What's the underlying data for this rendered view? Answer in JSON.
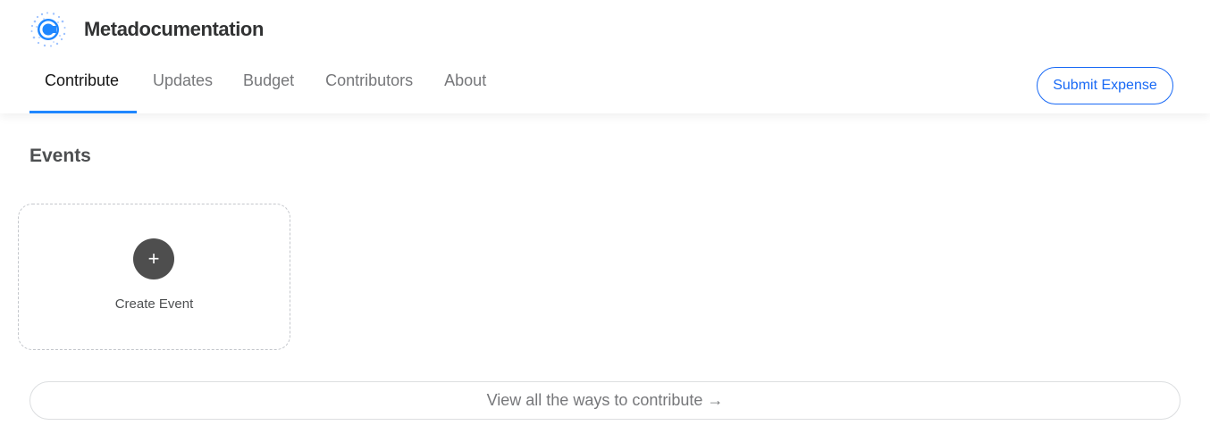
{
  "collective": {
    "name": "Metadocumentation",
    "logo_icon": "opencollective-logo-icon"
  },
  "nav": {
    "items": [
      {
        "label": "Contribute",
        "active": true
      },
      {
        "label": "Updates",
        "active": false
      },
      {
        "label": "Budget",
        "active": false
      },
      {
        "label": "Contributors",
        "active": false
      },
      {
        "label": "About",
        "active": false
      }
    ],
    "submit_expense_label": "Submit Expense"
  },
  "events": {
    "title": "Events",
    "create_card": {
      "icon": "plus-icon",
      "icon_glyph": "+",
      "label": "Create Event"
    }
  },
  "view_all": {
    "label": "View all the ways to contribute →"
  },
  "colors": {
    "accent": "#1869f5",
    "active_underline": "#1f87ff",
    "plus_circle": "#4e4e4e"
  }
}
